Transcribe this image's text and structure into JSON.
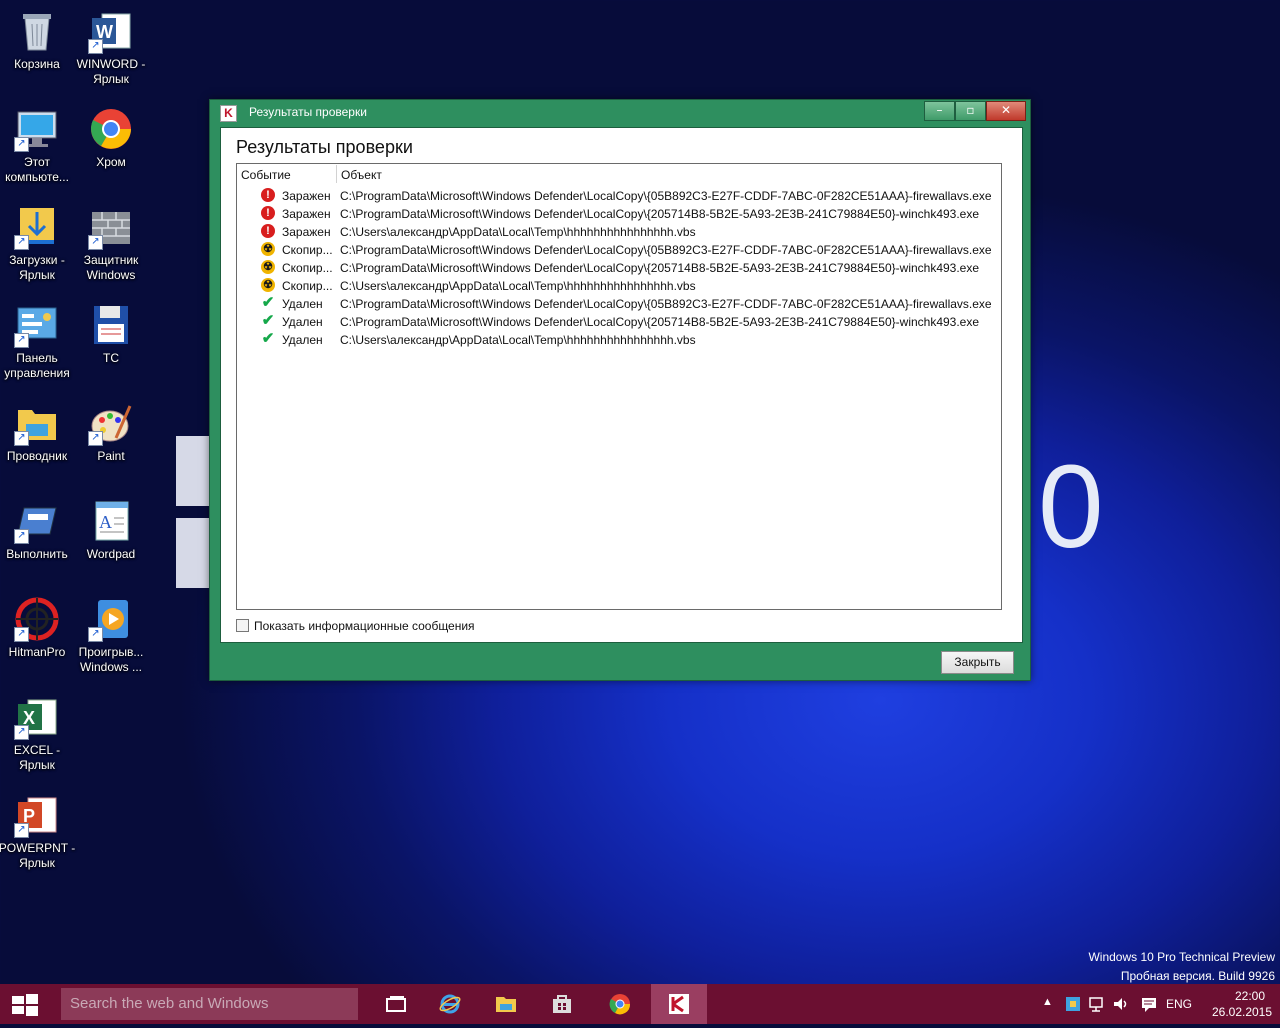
{
  "desktop": {
    "icons": [
      {
        "label": "Корзина"
      },
      {
        "label": "WINWORD - Ярлык"
      },
      {
        "label": "Этот компьюте..."
      },
      {
        "label": "Хром"
      },
      {
        "label": "Загрузки - Ярлык"
      },
      {
        "label": "Защитник Windows"
      },
      {
        "label": "Панель управления"
      },
      {
        "label": "TC"
      },
      {
        "label": "Проводник"
      },
      {
        "label": "Paint"
      },
      {
        "label": "Выполнить"
      },
      {
        "label": "Wordpad"
      },
      {
        "label": "HitmanPro"
      },
      {
        "label": "Проигрыв... Windows ..."
      },
      {
        "label": "EXCEL - Ярлык"
      },
      {
        "label": "POWERPNT - Ярлык"
      }
    ],
    "watermark_line1": "Windows 10 Pro Technical Preview",
    "watermark_line2": "Пробная версия. Build 9926",
    "logo_zero": "0"
  },
  "dialog": {
    "window_title": "Результаты проверки",
    "heading": "Результаты проверки",
    "columns": {
      "event": "Событие",
      "object": "Объект"
    },
    "rows": [
      {
        "status": "Заражен",
        "icon": "infected",
        "path": "C:\\ProgramData\\Microsoft\\Windows Defender\\LocalCopy\\{05B892C3-E27F-CDDF-7ABC-0F282CE51AAA}-firewallavs.exe"
      },
      {
        "status": "Заражен",
        "icon": "infected",
        "path": "C:\\ProgramData\\Microsoft\\Windows Defender\\LocalCopy\\{205714B8-5B2E-5A93-2E3B-241C79884E50}-winchk493.exe"
      },
      {
        "status": "Заражен",
        "icon": "infected",
        "path": "C:\\Users\\александр\\AppData\\Local\\Temp\\hhhhhhhhhhhhhhhh.vbs"
      },
      {
        "status": "Скопир...",
        "icon": "copied",
        "path": "C:\\ProgramData\\Microsoft\\Windows Defender\\LocalCopy\\{05B892C3-E27F-CDDF-7ABC-0F282CE51AAA}-firewallavs.exe"
      },
      {
        "status": "Скопир...",
        "icon": "copied",
        "path": "C:\\ProgramData\\Microsoft\\Windows Defender\\LocalCopy\\{205714B8-5B2E-5A93-2E3B-241C79884E50}-winchk493.exe"
      },
      {
        "status": "Скопир...",
        "icon": "copied",
        "path": "C:\\Users\\александр\\AppData\\Local\\Temp\\hhhhhhhhhhhhhhhh.vbs"
      },
      {
        "status": "Удален",
        "icon": "deleted",
        "path": "C:\\ProgramData\\Microsoft\\Windows Defender\\LocalCopy\\{05B892C3-E27F-CDDF-7ABC-0F282CE51AAA}-firewallavs.exe"
      },
      {
        "status": "Удален",
        "icon": "deleted",
        "path": "C:\\ProgramData\\Microsoft\\Windows Defender\\LocalCopy\\{205714B8-5B2E-5A93-2E3B-241C79884E50}-winchk493.exe"
      },
      {
        "status": "Удален",
        "icon": "deleted",
        "path": "C:\\Users\\александр\\AppData\\Local\\Temp\\hhhhhhhhhhhhhhhh.vbs"
      }
    ],
    "show_info_label": "Показать информационные сообщения",
    "show_info_checked": false,
    "close_button": "Закрыть",
    "colors": {
      "frame": "#2e8f5f",
      "infected": "#d81e1e",
      "copied": "#f0b400",
      "deleted": "#15a84a"
    }
  },
  "taskbar": {
    "search_placeholder": "Search the web and Windows",
    "apps": [
      "task-view-icon",
      "internet-explorer-icon",
      "file-explorer-icon",
      "store-icon",
      "chrome-icon",
      "kaspersky-icon"
    ],
    "language": "ENG",
    "time": "22:00",
    "date": "26.02.2015",
    "color": "#6b0f31"
  }
}
